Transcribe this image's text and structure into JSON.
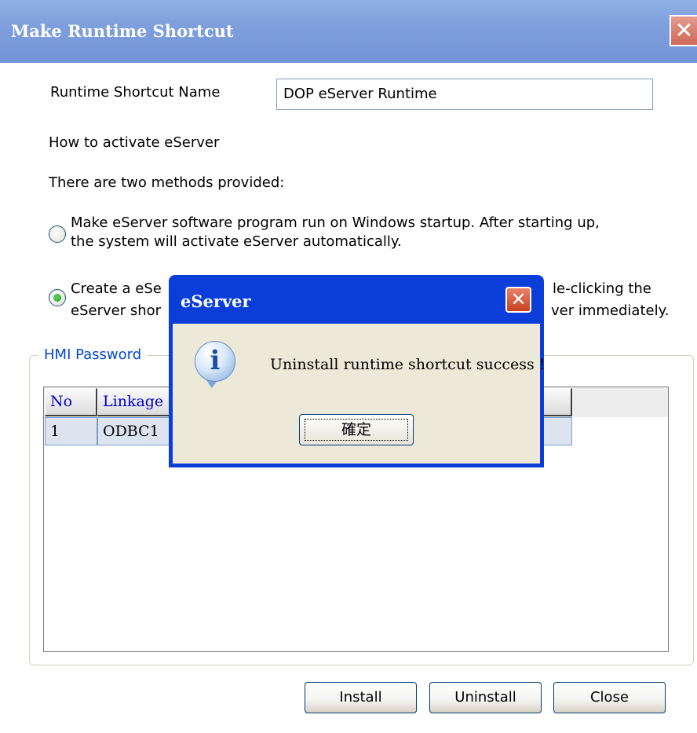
{
  "main_window": {
    "title": "Make Runtime Shortcut",
    "close_glyph": "✕"
  },
  "form": {
    "shortcut_name_label": "Runtime Shortcut Name",
    "shortcut_name_value": "DOP eServer Runtime",
    "how_to_activate": "How to activate eServer",
    "methods_intro": "There are two methods provided:",
    "option1_line1": "Make eServer software program run on Windows startup. After starting up,",
    "option1_line2": "the system will activate eServer automatically.",
    "option1_selected": false,
    "option2_line1_left": "Create a eSe",
    "option2_line1_right": "le-clicking the",
    "option2_line2_left": "eServer shor",
    "option2_line2_right": "ver immediately.",
    "option2_selected": true
  },
  "hmi_password": {
    "group_label": "HMI Password",
    "columns": [
      "No",
      "Linkage"
    ],
    "rows": [
      {
        "no": "1",
        "linkage": "ODBC1"
      }
    ]
  },
  "buttons": {
    "install": "Install",
    "uninstall": "Uninstall",
    "close": "Close"
  },
  "dialog": {
    "title": "eServer",
    "close_glyph": "✕",
    "icon_glyph": "i",
    "message": "Uninstall runtime shortcut success !",
    "ok_label": "確定"
  },
  "colors": {
    "main_titlebar": "#7f9fdc",
    "dialog_titlebar": "#0b3ed8",
    "group_label": "#0046d5",
    "grid_header_text": "#0000cc"
  }
}
